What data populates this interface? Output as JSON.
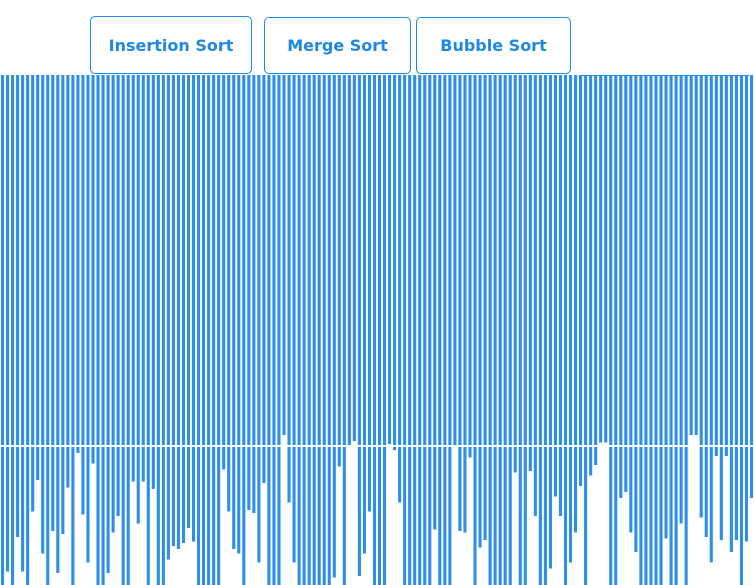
{
  "toolbar": {
    "insertion_label": "Insertion Sort",
    "merge_label": "Merge Sort",
    "bubble_label": "Bubble Sort"
  },
  "colors": {
    "accent": "#1e88e5",
    "bar": "#2f8fe6",
    "background": "#ffffff"
  },
  "array": {
    "count": 150,
    "values": [
      100,
      91,
      100,
      68,
      91,
      100,
      51,
      30,
      79,
      100,
      64,
      92,
      66,
      35,
      100,
      12,
      53,
      85,
      19,
      100,
      100,
      92,
      65,
      54,
      100,
      100,
      31,
      59,
      31,
      100,
      36,
      100,
      100,
      83,
      74,
      76,
      72,
      62,
      71,
      100,
      100,
      100,
      100,
      100,
      23,
      51,
      76,
      79,
      100,
      50,
      52,
      85,
      32,
      100,
      100,
      100,
      0,
      45,
      85,
      100,
      100,
      100,
      100,
      100,
      100,
      100,
      95,
      21,
      100,
      8,
      4,
      94,
      79,
      51,
      100,
      100,
      100,
      6,
      10,
      45,
      100,
      100,
      100,
      100,
      100,
      100,
      63,
      100,
      100,
      100,
      7,
      64,
      65,
      15,
      100,
      75,
      70,
      100,
      100,
      100,
      100,
      100,
      25,
      100,
      100,
      24,
      54,
      100,
      100,
      89,
      41,
      54,
      100,
      85,
      65,
      34,
      100,
      27,
      20,
      5,
      5,
      100,
      100,
      42,
      38,
      65,
      78,
      100,
      100,
      100,
      100,
      100,
      69,
      100,
      100,
      59,
      100,
      0,
      0,
      55,
      68,
      85,
      14,
      70,
      14,
      78,
      70,
      100,
      71,
      42
    ]
  }
}
